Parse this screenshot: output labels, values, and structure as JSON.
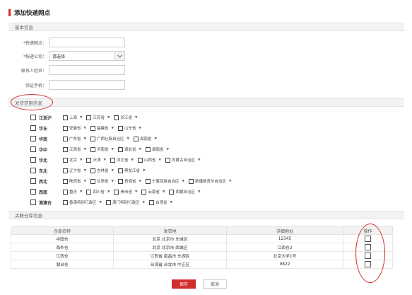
{
  "page": {
    "title": "添加快递网点"
  },
  "colors": {
    "accent": "#d12d2d",
    "annotation": "#d33030"
  },
  "basic_info": {
    "section_title": "基本信息",
    "fields": [
      {
        "label": "*快递网点：",
        "value": ""
      },
      {
        "label": "*快递公司：",
        "value": "请选择"
      },
      {
        "label": "联系人姓名：",
        "value": ""
      },
      {
        "label": "验证手机：",
        "value": ""
      }
    ]
  },
  "delivery_range": {
    "section_title": "发货范围信息",
    "regions": [
      {
        "name": "江浙沪",
        "provinces": [
          "上海",
          "江苏省",
          "浙江省"
        ]
      },
      {
        "name": "华东",
        "provinces": [
          "安徽省",
          "福建省",
          "山东省"
        ]
      },
      {
        "name": "华南",
        "provinces": [
          "广东省",
          "广西壮族自治区",
          "海南省"
        ]
      },
      {
        "name": "华中",
        "provinces": [
          "江西省",
          "河南省",
          "湖北省",
          "湖南省"
        ]
      },
      {
        "name": "华北",
        "provinces": [
          "北京",
          "天津",
          "河北省",
          "山西省",
          "内蒙古自治区"
        ]
      },
      {
        "name": "东北",
        "provinces": [
          "辽宁省",
          "吉林省",
          "黑龙江省"
        ]
      },
      {
        "name": "西北",
        "provinces": [
          "陕西省",
          "甘肃省",
          "青海省",
          "宁夏回族自治区",
          "新疆维吾尔自治区"
        ]
      },
      {
        "name": "西南",
        "provinces": [
          "重庆",
          "四川省",
          "贵州省",
          "云南省",
          "西藏自治区"
        ]
      },
      {
        "name": "港澳台",
        "provinces": [
          "香港特别行政区",
          "澳门特别行政区",
          "台湾省"
        ]
      }
    ]
  },
  "warehouse": {
    "section_title": "关联仓库信息",
    "columns": [
      "仓库名称",
      "发货地",
      "详细地址",
      "操作"
    ],
    "rows": [
      {
        "name": "中国仓",
        "origin": "北京 北京市 东城区",
        "address": "12345"
      },
      {
        "name": "海外仓",
        "origin": "北京 北京市 西城区",
        "address": "江西仓2"
      },
      {
        "name": "江西仓",
        "origin": "江西省 南昌市 东湖区",
        "address": "北京大学1号"
      },
      {
        "name": "湖台仓",
        "origin": "台湾省 台北市 中正区",
        "address": "9822"
      }
    ]
  },
  "buttons": {
    "save": "保存",
    "cancel": "取消"
  },
  "icons": {
    "dropdown": "chevron-down-icon",
    "province_arrow": "caret-down-icon"
  }
}
